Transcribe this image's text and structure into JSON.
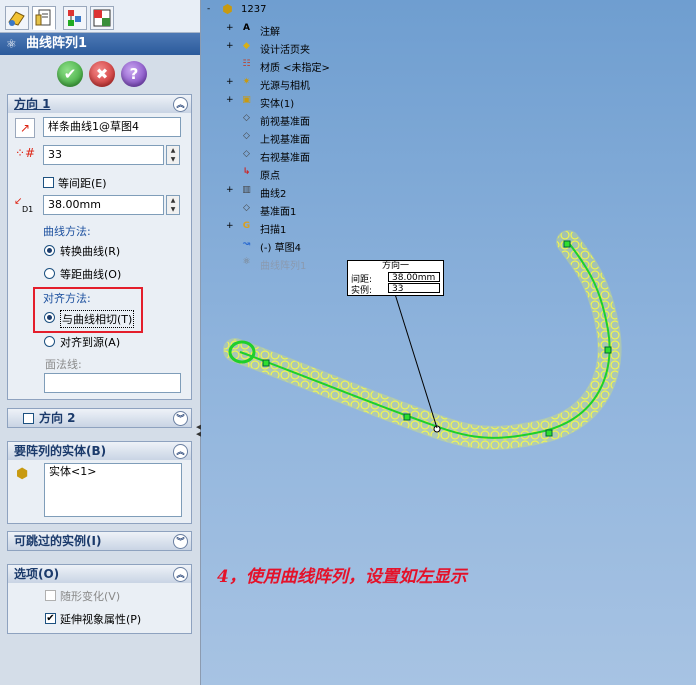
{
  "feature_title": "曲线阵列1",
  "icons": {
    "tab1": "feature-manager-icon",
    "tab2": "property-manager-icon",
    "tab3": "configuration-manager-icon",
    "tab4": "display-manager-icon",
    "ok": "check-icon",
    "cancel": "x-icon",
    "help": "question-icon"
  },
  "ok_buttons": {
    "ok": "✔",
    "cancel": "✖",
    "help": "?"
  },
  "direction1": {
    "header": "方向 1",
    "curve_field": "样条曲线1@草图4",
    "count_value": "33",
    "equal_spacing_label": "等间距(E)",
    "spacing_value": "38.00mm",
    "d1_label": "D1",
    "curve_method_label": "曲线方法:",
    "curve_method_options": [
      "转换曲线(R)",
      "等距曲线(O)"
    ],
    "curve_method_selected": 0,
    "align_method_label": "对齐方法:",
    "align_options": [
      "与曲线相切(T)",
      "对齐到源(A)"
    ],
    "align_selected": 0,
    "face_normal_label": "面法线:",
    "face_normal_value": ""
  },
  "direction2": {
    "header": "方向 2",
    "checked": false
  },
  "bodies": {
    "header": "要阵列的实体(B)",
    "items": [
      "实体<1>"
    ]
  },
  "skip_instances": {
    "header": "可跳过的实例(I)"
  },
  "options": {
    "header": "选项(O)",
    "items": [
      {
        "label": "随形变化(V)",
        "checked": false,
        "disabled": true
      },
      {
        "label": "延伸视象属性(P)",
        "checked": true,
        "disabled": false
      }
    ]
  },
  "tree": {
    "root": "1237",
    "items": [
      {
        "label": "注解",
        "icon": "annotation-icon",
        "expandable": true
      },
      {
        "label": "设计活页夹",
        "icon": "design-binder-icon",
        "expandable": true
      },
      {
        "label": "材质 <未指定>",
        "icon": "material-icon",
        "expandable": false
      },
      {
        "label": "光源与相机",
        "icon": "lights-icon",
        "expandable": true
      },
      {
        "label": "实体(1)",
        "icon": "solid-bodies-icon",
        "expandable": true
      },
      {
        "label": "前视基准面",
        "icon": "plane-icon",
        "expandable": false
      },
      {
        "label": "上视基准面",
        "icon": "plane-icon",
        "expandable": false
      },
      {
        "label": "右视基准面",
        "icon": "plane-icon",
        "expandable": false
      },
      {
        "label": "原点",
        "icon": "origin-icon",
        "expandable": false
      },
      {
        "label": "曲线2",
        "icon": "curve-icon",
        "expandable": true
      },
      {
        "label": "基准面1",
        "icon": "plane-icon",
        "expandable": false
      },
      {
        "label": "扫描1",
        "icon": "sweep-icon",
        "expandable": true
      },
      {
        "label": "(-) 草图4",
        "icon": "sketch-icon",
        "expandable": false
      },
      {
        "label": "曲线阵列1",
        "icon": "curve-pattern-icon",
        "expandable": false
      }
    ]
  },
  "callout": {
    "title": "方向一",
    "spacing_label": "间距:",
    "spacing_value": "38.00mm",
    "instances_label": "实例:",
    "instances_value": "33"
  },
  "note": "4，使用曲线阵列，设置如左显示",
  "colors": {
    "highlight": "#e41e2b",
    "preview": "#ffff3c",
    "curve": "#1fcf2a"
  }
}
